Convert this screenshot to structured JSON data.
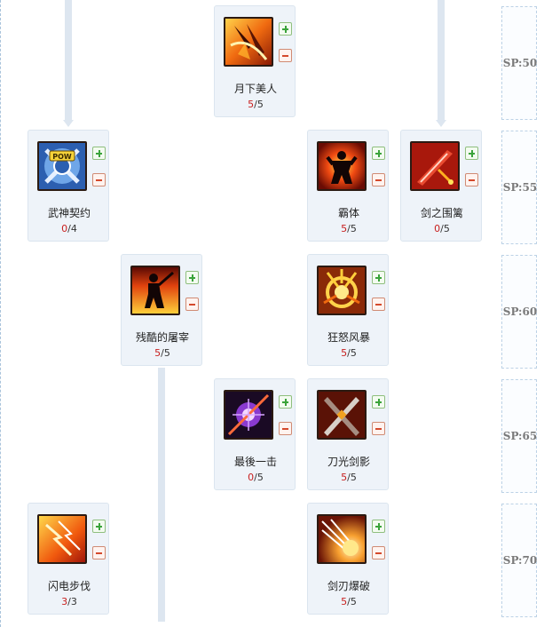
{
  "sp_tiers": [
    {
      "label": "SP:50"
    },
    {
      "label": "SP:55"
    },
    {
      "label": "SP:60"
    },
    {
      "label": "SP:65"
    },
    {
      "label": "SP:70"
    }
  ],
  "skills": {
    "moonlight_beauty": {
      "name": "月下美人",
      "current": "5",
      "separator": "/",
      "max": "5",
      "icon": "flaming-sword-slash-icon"
    },
    "martial_god_pact": {
      "name": "武神契约",
      "current": "0",
      "separator": "/",
      "max": "4",
      "icon": "pow-emblem-icon"
    },
    "tyrant_body": {
      "name": "霸体",
      "current": "5",
      "separator": "/",
      "max": "5",
      "icon": "power-pose-silhouette-icon"
    },
    "sword_siege": {
      "name": "剑之围篱",
      "current": "0",
      "separator": "/",
      "max": "5",
      "icon": "crimson-blade-icon"
    },
    "brutal_slaughter": {
      "name": "残酷的屠宰",
      "current": "5",
      "separator": "/",
      "max": "5",
      "icon": "warrior-silhouette-fire-icon"
    },
    "raging_storm": {
      "name": "狂怒风暴",
      "current": "5",
      "separator": "/",
      "max": "5",
      "icon": "golden-storm-icon"
    },
    "final_strike": {
      "name": "最後一击",
      "current": "0",
      "separator": "/",
      "max": "5",
      "icon": "purple-orb-strike-icon"
    },
    "blade_light_shadow": {
      "name": "刀光剑影",
      "current": "5",
      "separator": "/",
      "max": "5",
      "icon": "crossed-swords-icon"
    },
    "lightning_step": {
      "name": "闪电步伐",
      "current": "3",
      "separator": "/",
      "max": "3",
      "icon": "lightning-bolts-icon"
    },
    "blade_burst": {
      "name": "剑刃爆破",
      "current": "5",
      "separator": "/",
      "max": "5",
      "icon": "blade-burst-explosion-icon"
    }
  },
  "colors": {
    "level_current": "#c8201f",
    "plus_button": "#3aa33a",
    "minus_button": "#d4492c",
    "card_background": "#eef3f9"
  }
}
